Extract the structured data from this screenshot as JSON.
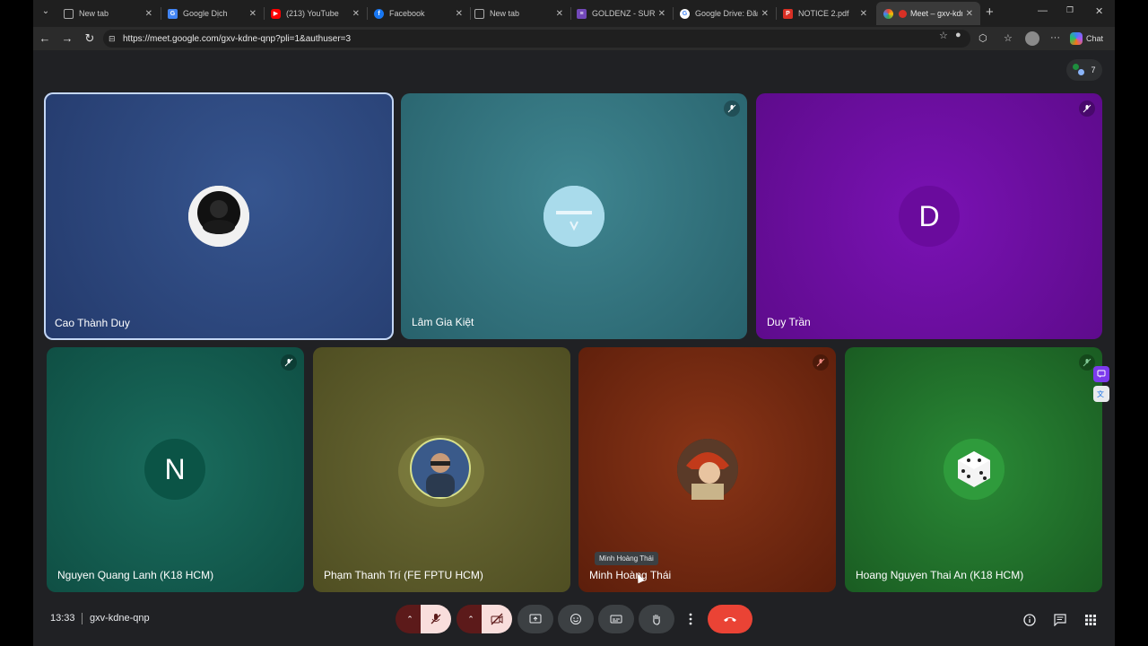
{
  "browser": {
    "tabs": [
      {
        "label": "New tab",
        "favicon": "page-icon",
        "color": "#5f6368",
        "active": false
      },
      {
        "label": "Google Dịch",
        "favicon": "translate-icon",
        "color": "#4285f4",
        "active": false
      },
      {
        "label": "(213) YouTube",
        "favicon": "youtube-icon",
        "color": "#ff0000",
        "active": false
      },
      {
        "label": "Facebook",
        "favicon": "facebook-icon",
        "color": "#1877f2",
        "active": false
      },
      {
        "label": "New tab",
        "favicon": "page-icon",
        "color": "#5f6368",
        "active": false
      },
      {
        "label": "GOLDENZ - SURVE",
        "favicon": "forms-icon",
        "color": "#7248b9",
        "active": false
      },
      {
        "label": "Google Drive: Đăng",
        "favicon": "google-icon",
        "color": "#ffffff",
        "active": false
      },
      {
        "label": "NOTICE 2.pdf",
        "favicon": "pdf-icon",
        "color": "#d93025",
        "active": false
      },
      {
        "label": "Meet – gxv-kdn",
        "favicon": "meet-icon",
        "color": "#00897b",
        "active": true
      }
    ],
    "url": "https://meet.google.com/gxv-kdne-qnp?pli=1&authuser=3",
    "copilot_label": "Chat"
  },
  "meet": {
    "participant_count": "7",
    "tiles": [
      {
        "name": "Cao Thành Duy",
        "initial": "",
        "bg": "#2a4479"
      },
      {
        "name": "Lâm Gia Kiệt",
        "initial": "",
        "bg": "#2f6f7a"
      },
      {
        "name": "Duy Trần",
        "initial": "D",
        "bg": "#6b0b9e"
      },
      {
        "name": "Nguyen Quang Lanh (K18 HCM)",
        "initial": "N",
        "bg": "#0f5a4e"
      },
      {
        "name": "Phạm Thanh Trí (FE FPTU HCM)",
        "initial": "",
        "bg": "#5b5a2a"
      },
      {
        "name": "Minh Hoàng Thái",
        "initial": "",
        "bg": "#6e2812"
      },
      {
        "name": "Hoang Nguyen Thai An (K18 HCM)",
        "initial": "",
        "bg": "#1f6b2c"
      }
    ],
    "tooltip": "Minh Hoàng Thái",
    "time": "13:33",
    "meeting_code": "gxv-kdne-qnp"
  }
}
